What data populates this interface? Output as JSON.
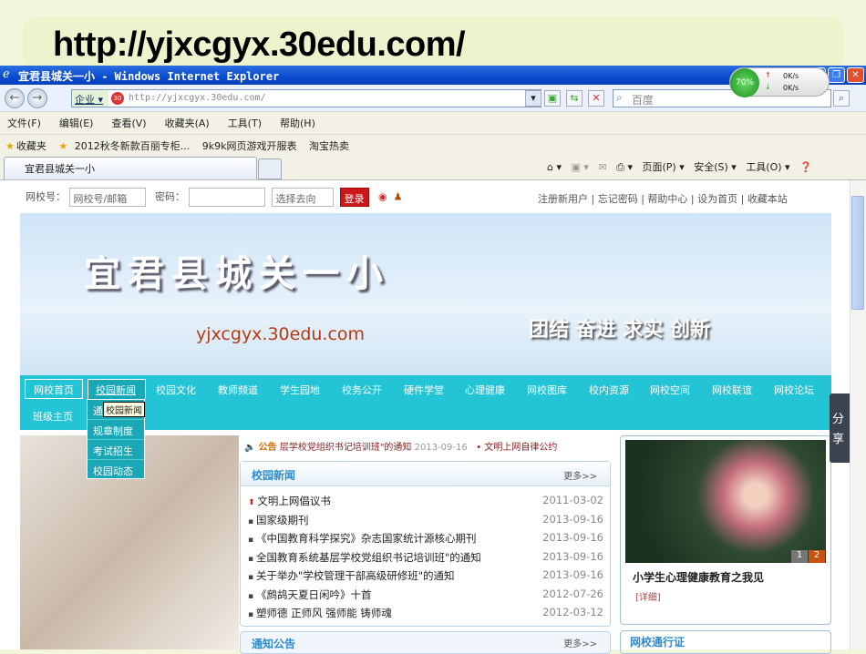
{
  "slide": {
    "url": "http://yjxcgyx.30edu.com/"
  },
  "window": {
    "title": "宜君县城关一小 - Windows Internet Explorer",
    "minimize": "_",
    "restore": "❐",
    "close": "✕"
  },
  "speed": {
    "percent": "70%",
    "up": "0K/s",
    "down": "0K/s"
  },
  "address": {
    "zone": "企业 ▾",
    "url": "http://yjxcgyx.30edu.com/",
    "search_placeholder": "百度"
  },
  "menu": [
    "文件(F)",
    "编辑(E)",
    "查看(V)",
    "收藏夹(A)",
    "工具(T)",
    "帮助(H)"
  ],
  "favorites": {
    "label": "收藏夹",
    "items": [
      "2012秋冬新款百丽专柜...",
      "9k9k网页游戏开服表",
      "淘宝热卖"
    ]
  },
  "tab": {
    "title": "宜君县城关一小"
  },
  "commandbar": {
    "page": "页面(P) ▾",
    "safety": "安全(S) ▾",
    "tools": "工具(O) ▾"
  },
  "login": {
    "account_label": "网校号：",
    "account_placeholder": "网校号/邮箱",
    "password_label": "密码：",
    "goto": "选择去向",
    "submit": "登录"
  },
  "toplinks": [
    "注册新用户",
    "忘记密码",
    "帮助中心",
    "设为首页",
    "收藏本站"
  ],
  "banner": {
    "title": "宜君县城关一小",
    "url": "yjxcgyx.30edu.com",
    "motto": "团结 奋进 求实 创新"
  },
  "nav": [
    "网校首页",
    "校园新闻",
    "校园文化",
    "教师频道",
    "学生园地",
    "校务公开",
    "硬件学堂",
    "心理健康",
    "网校图库",
    "校内资源",
    "网校空间",
    "网校联谊",
    "网校论坛",
    "班级主页"
  ],
  "dropdown": [
    "通知公告",
    "规章制度",
    "考试招生",
    "校园动态"
  ],
  "tooltip": "校园新闻",
  "announcement": {
    "label": "公告",
    "text": "层学校党组织书记培训班\"的通知",
    "date": "2013-09-16",
    "next": "• 文明上网自律公约"
  },
  "news": {
    "title": "校园新闻",
    "more": "更多>>",
    "items": [
      {
        "title": "文明上网倡议书",
        "date": "2011-03-02"
      },
      {
        "title": "国家级期刊",
        "date": "2013-09-16"
      },
      {
        "title": "《中国教育科学探究》杂志国家统计源核心期刊",
        "date": "2013-09-16"
      },
      {
        "title": "全国教育系统基层学校党组织书记培训班\"的通知",
        "date": "2013-09-16"
      },
      {
        "title": "关于举办\"学校管理干部高级研修班\"的通知",
        "date": "2013-09-16"
      },
      {
        "title": "《鹧鸪天夏日闲吟》十首",
        "date": "2012-07-26"
      },
      {
        "title": "塑师德 正师风 强师能 铸师魂",
        "date": "2012-03-12"
      }
    ]
  },
  "notice": {
    "title": "通知公告",
    "more": "更多>>"
  },
  "feature": {
    "title": "小学生心理健康教育之我见",
    "detail": "[详细]",
    "pages": [
      "1",
      "2"
    ]
  },
  "pass": {
    "title": "网校通行证"
  },
  "share": "分享"
}
